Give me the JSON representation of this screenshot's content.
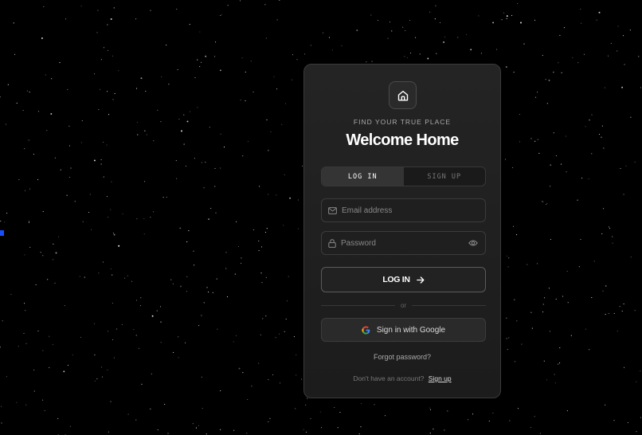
{
  "colors": {
    "background": "#000000",
    "card": "#1f1f1f",
    "accent_marker": "#1a4dff"
  },
  "header": {
    "logo_icon": "home-icon",
    "eyebrow": "FIND YOUR TRUE PLACE",
    "title": "Welcome Home"
  },
  "tabs": [
    {
      "label": "LOG IN",
      "active": true
    },
    {
      "label": "SIGN UP",
      "active": false
    }
  ],
  "form": {
    "email": {
      "icon": "mail-icon",
      "placeholder": "Email address",
      "value": ""
    },
    "password": {
      "icon": "lock-icon",
      "placeholder": "Password",
      "value": "",
      "toggle_icon": "eye-icon"
    },
    "submit_label": "LOG IN",
    "submit_icon": "arrow-right-icon"
  },
  "divider_text": "or",
  "google": {
    "label": "Sign in with Google",
    "icon": "google-icon"
  },
  "forgot_password": "Forgot password?",
  "signup": {
    "prompt": "Don't have an account?",
    "link": "Sign up"
  }
}
